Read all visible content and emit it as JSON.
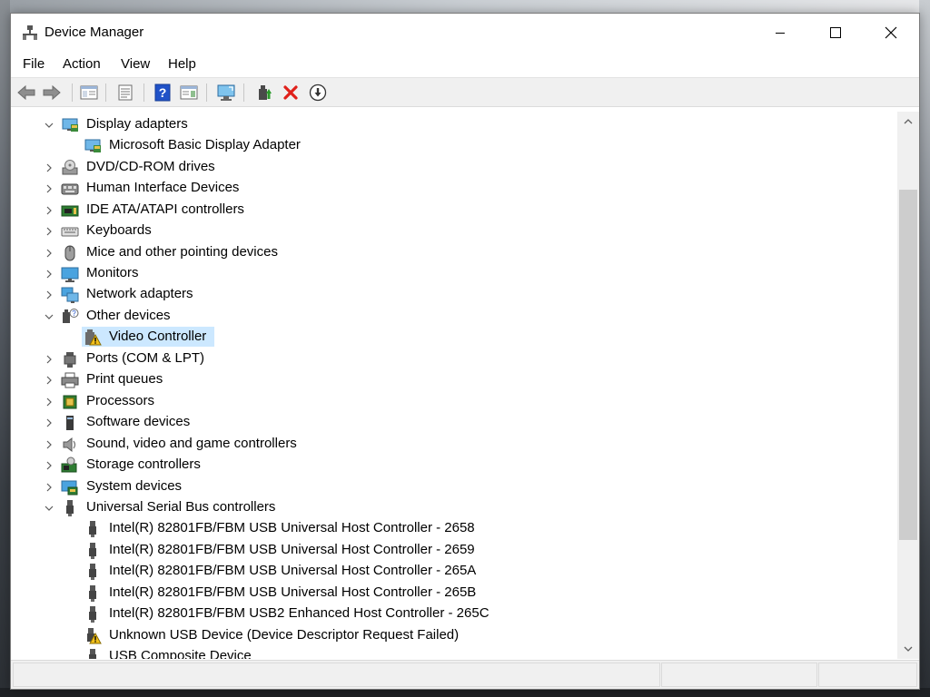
{
  "window": {
    "title": "Device Manager"
  },
  "menu": {
    "items": [
      "File",
      "Action",
      "Help"
    ],
    "view": "View"
  },
  "toolbar": {
    "buttons": [
      "back-icon",
      "forward-icon",
      "show-hide-console-tree-icon",
      "properties-icon",
      "help-icon",
      "action-pane-icon",
      "scan-hardware-icon",
      "update-driver-icon",
      "uninstall-icon",
      "disable-icon"
    ],
    "colors": {
      "uninstall": "#e0201a",
      "help": "#2052c8",
      "update": "#2a9a2a"
    }
  },
  "tree": {
    "display_adapters": "Display adapters",
    "ms_basic_display": "Microsoft Basic Display Adapter",
    "dvd": "DVD/CD-ROM drives",
    "hid": "Human Interface Devices",
    "ide": "IDE ATA/ATAPI controllers",
    "keyboards": "Keyboards",
    "mice": "Mice and other pointing devices",
    "monitors": "Monitors",
    "network": "Network adapters",
    "other": "Other devices",
    "video_controller": "Video Controller",
    "ports": "Ports (COM & LPT)",
    "print": "Print queues",
    "processors": "Processors",
    "software": "Software devices",
    "sound": "Sound, video and game controllers",
    "storage": "Storage controllers",
    "system": "System devices",
    "usb": "Universal Serial Bus controllers",
    "usb_2658": "Intel(R) 82801FB/FBM USB Universal Host Controller - 2658",
    "usb_2659": "Intel(R) 82801FB/FBM USB Universal Host Controller - 2659",
    "usb_265a": "Intel(R) 82801FB/FBM USB Universal Host Controller - 265A",
    "usb_265b": "Intel(R) 82801FB/FBM USB Universal Host Controller - 265B",
    "usb_265c": "Intel(R) 82801FB/FBM USB2 Enhanced Host Controller - 265C",
    "usb_unknown": "Unknown USB Device (Device Descriptor Request Failed)",
    "usb_composite": "USB Composite Device"
  },
  "selection": {
    "selected": "Video Controller",
    "highlight_color": "#cce8ff"
  }
}
